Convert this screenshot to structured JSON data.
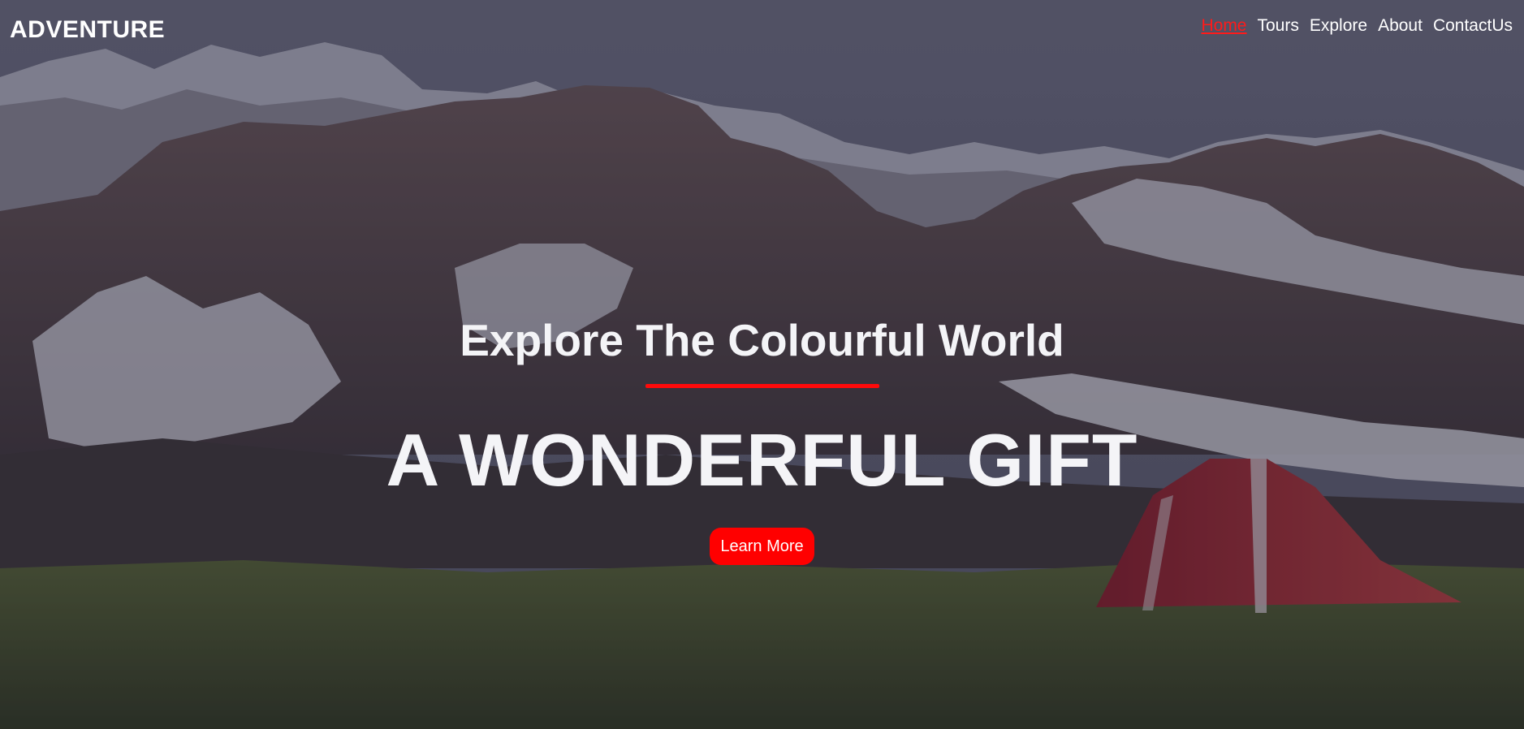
{
  "brand": "ADVENTURE",
  "nav": {
    "items": [
      {
        "label": "Home",
        "active": true
      },
      {
        "label": "Tours",
        "active": false
      },
      {
        "label": "Explore",
        "active": false
      },
      {
        "label": "About",
        "active": false
      },
      {
        "label": "ContactUs",
        "active": false
      }
    ]
  },
  "hero": {
    "subtitle": "Explore The Colourful World",
    "headline": "A WONDERFUL GIFT",
    "cta_label": "Learn More",
    "background_image": "mountains-tent-photo"
  },
  "colors": {
    "accent": "#ff0000",
    "active_link": "#ff1a1a",
    "text": "#ffffff"
  }
}
